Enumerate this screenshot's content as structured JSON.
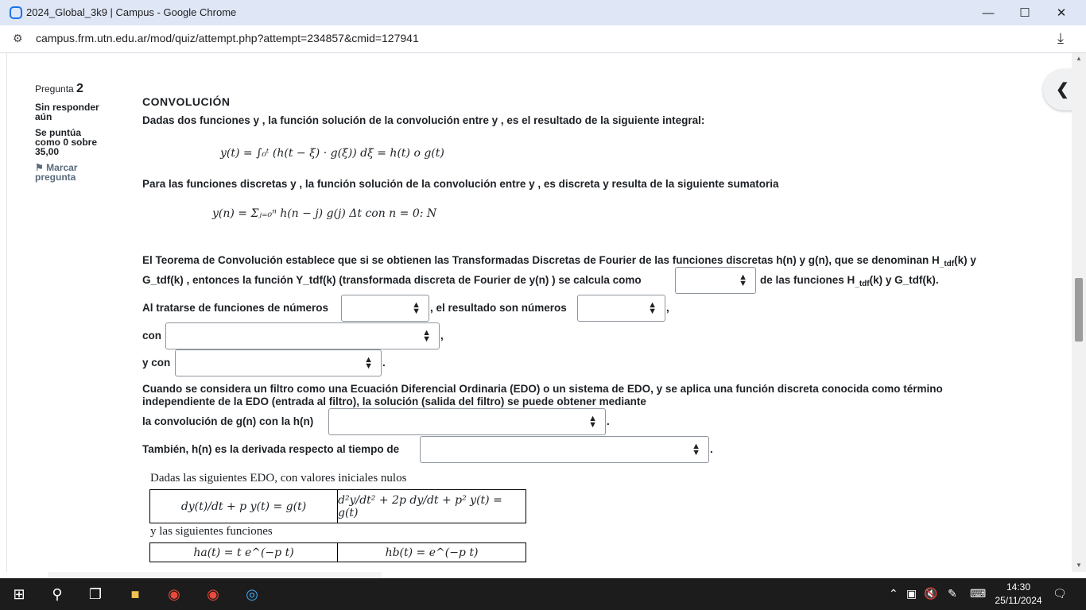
{
  "window": {
    "title": "2024_Global_3k9 | Campus - Google Chrome",
    "min_icon": "minimize-icon",
    "max_icon": "maximize-icon",
    "close_icon": "close-icon"
  },
  "address": {
    "url": "campus.frm.utn.edu.ar/mod/quiz/attempt.php?attempt=234857&cmid=127941"
  },
  "question_info": {
    "label": "Pregunta",
    "number": "2",
    "state": "Sin responder aún",
    "grade": "Se puntúa como 0 sobre 35,00",
    "flag": "Marcar pregunta"
  },
  "question": {
    "heading": "CONVOLUCIÓN",
    "p1": "Dadas dos funciones  y , la función  solución de la convolución entre  y , es el resultado de la siguiente integral:",
    "eq1": "y(t) = ∫₀ᵗ (h(t − ξ) · g(ξ)) dξ = h(t) o g(t)",
    "p2": "Para las funciones discretas  y , la función  solución de la convolución entre  y , es discreta y resulta de la siguiente sumatoria",
    "eq2": "y(n) = Σⱼ₌₀ⁿ h(n − j) g(j) Δt      con    n = 0: N",
    "p3a": "El Teorema de Convolución establece que si se obtienen las Transformadas Discretas de Fourier de las funciones discretas h(n)   y g(n), que se denominan  H",
    "p3a_sub": "_tdf",
    "p3a_end": "(k) y",
    "p3b": "G_tdf(k) , entonces la función Y_tdf(k)  (transformada discreta de Fourier de y(n) ) se calcula como",
    "p3c": "de las funciones   H",
    "p3c_sub": "_tdf",
    "p3c_end": "(k) y G_tdf(k).",
    "p4a": "Al tratarse de funciones de números",
    "p4b": ", el resultado son números",
    "p4c": ",",
    "p5a": "con",
    "p5b": ",",
    "p6a": "y con",
    "p6b": ".",
    "p7": "Cuando se considera un filtro como una Ecuación Diferencial Ordinaria (EDO) o un sistema de EDO, y se aplica una función discreta conocida  como término",
    "p7b": "independiente de la EDO (entrada al filtro), la solución  (salida del filtro) se puede obtener mediante",
    "p8a": "la convolución de g(n) con la h(n)",
    "p8b": ".",
    "p9a": "También, h(n) es la derivada respecto al tiempo de",
    "p9b": ".",
    "edo_intro": "Dadas las siguientes EDO, con valores iniciales nulos",
    "edo1": "dy(t)/dt + p  y(t) = g(t)",
    "edo2": "d²y/dt² + 2p dy/dt + p²  y(t) = g(t)",
    "fun_intro": "y las siguientes funciones",
    "fun1": "ha(t) = t e^(−p t)",
    "fun2": "hb(t) = e^(−p t)"
  },
  "taskbar": {
    "time": "14:30",
    "date": "25/11/2024"
  }
}
